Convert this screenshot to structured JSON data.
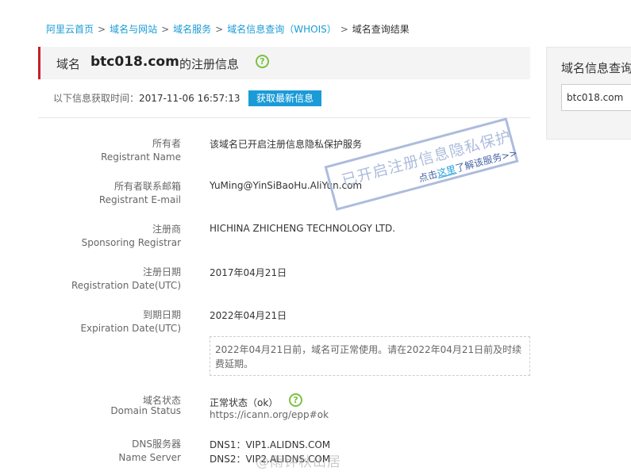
{
  "breadcrumb": {
    "items": [
      "阿里云首页",
      "域名与网站",
      "域名服务",
      "域名信息查询（WHOIS）"
    ],
    "current": "域名查询结果"
  },
  "header": {
    "prefix": "域名",
    "domain": "btc018.com",
    "suffix": "的注册信息",
    "help": "?"
  },
  "fetch": {
    "label": "以下信息获取时间：",
    "time": "2017-11-06 16:57:13",
    "refresh_label": "获取最新信息"
  },
  "fields": {
    "registrant_name": {
      "cn": "所有者",
      "en": "Registrant Name",
      "value": "该域名已开启注册信息隐私保护服务"
    },
    "registrant_email": {
      "cn": "所有者联系邮箱",
      "en": "Registrant E-mail",
      "value": "YuMing@YinSiBaoHu.AliYun.com"
    },
    "registrar": {
      "cn": "注册商",
      "en": "Sponsoring Registrar",
      "value": "HICHINA ZHICHENG TECHNOLOGY LTD."
    },
    "registration_date": {
      "cn": "注册日期",
      "en": "Registration Date(UTC)",
      "value": "2017年04月21日"
    },
    "expiration_date": {
      "cn": "到期日期",
      "en": "Expiration Date(UTC)",
      "value": "2022年04月21日"
    },
    "domain_status": {
      "cn": "域名状态",
      "en": "Domain Status",
      "value": "正常状态（ok）",
      "link": "https://icann.org/epp#ok"
    },
    "name_server": {
      "cn": "DNS服务器",
      "en": "Name Server",
      "dns1": "DNS1：VIP1.ALIDNS.COM",
      "dns2": "DNS2：VIP2.ALIDNS.COM"
    }
  },
  "expiry_note": "2022年04月21日前，域名可正常使用。请在2022年04月21日前及时续费延期。",
  "stamp": {
    "title": "已开启注册信息隐私保护",
    "link_prefix": "点击",
    "link_text": "这里",
    "link_suffix": "了解该服务>>"
  },
  "side": {
    "title": "域名信息查询",
    "input_value": "btc018.com"
  },
  "watermark": "@雨钟秋山居"
}
